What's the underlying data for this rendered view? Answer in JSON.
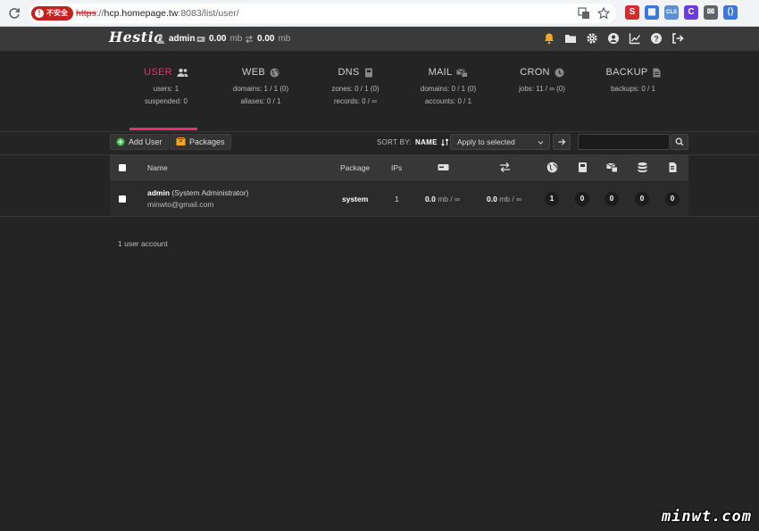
{
  "browser": {
    "badge": "不安全",
    "url_scheme": "https",
    "url_host": "hcp.homepage.tw",
    "url_rest": ":8083/list/user/",
    "extensions": [
      {
        "icon": "s-icon",
        "color": "#d42d2d",
        "glyph": "S"
      },
      {
        "icon": "grid-icon",
        "color": "#3a79d8",
        "glyph": "▦"
      },
      {
        "icon": "cls-icon",
        "color": "#5b8fd6",
        "glyph": "CLS"
      },
      {
        "icon": "c-icon",
        "color": "#6a3cdb",
        "glyph": "C"
      },
      {
        "icon": "mail-icon",
        "color": "#5f6368",
        "glyph": "✉"
      },
      {
        "icon": "code-icon",
        "color": "#3a79d8",
        "glyph": "⟨⟩"
      }
    ]
  },
  "topbar": {
    "logo": "Hestia",
    "user": "admin",
    "disk_value": "0.00",
    "disk_unit": "mb",
    "bw_value": "0.00",
    "bw_unit": "mb",
    "accent": "#f5a623"
  },
  "tabs": [
    {
      "key": "user",
      "label": "USER",
      "icon": "users-icon",
      "active": true,
      "lines": [
        "users: 1",
        "suspended: 0"
      ]
    },
    {
      "key": "web",
      "label": "WEB",
      "icon": "globe-icon",
      "active": false,
      "lines": [
        "domains: 1 / 1 (0)",
        "aliases: 0 / 1"
      ]
    },
    {
      "key": "dns",
      "label": "DNS",
      "icon": "book-icon",
      "active": false,
      "lines": [
        "zones: 0 / 1 (0)",
        "records: 0 / ∞"
      ]
    },
    {
      "key": "mail",
      "label": "MAIL",
      "icon": "mail-server-icon",
      "active": false,
      "lines": [
        "domains: 0 / 1 (0)",
        "accounts: 0 / 1"
      ]
    },
    {
      "key": "cron",
      "label": "CRON",
      "icon": "clock-icon",
      "active": false,
      "lines": [
        "jobs: 11 / ∞ (0)"
      ]
    },
    {
      "key": "backup",
      "label": "BACKUP",
      "icon": "file-icon",
      "active": false,
      "lines": [
        "backups: 0 / 1"
      ]
    }
  ],
  "toolbar": {
    "add_user": "Add User",
    "packages": "Packages",
    "sort_by": "SORT BY:",
    "sort_value": "NAME",
    "apply_selected": "Apply to selected",
    "search_value": ""
  },
  "table": {
    "headers": {
      "name": "Name",
      "package": "Package",
      "ips": "IPs"
    },
    "rows": [
      {
        "username": "admin",
        "fullname": "(System Administrator)",
        "email": "minwto@gmail.com",
        "package": "system",
        "ips": "1",
        "disk_value": "0.0",
        "disk_rest": "mb / ∞",
        "bw_value": "0.0",
        "bw_rest": "mb / ∞",
        "web": "1",
        "dns": "0",
        "mail": "0",
        "db": "0",
        "backup": "0"
      }
    ]
  },
  "footer": {
    "count": "1 user account"
  },
  "watermark": "minwt.com",
  "colors": {
    "active": "#e5306e",
    "background": "#242424"
  }
}
